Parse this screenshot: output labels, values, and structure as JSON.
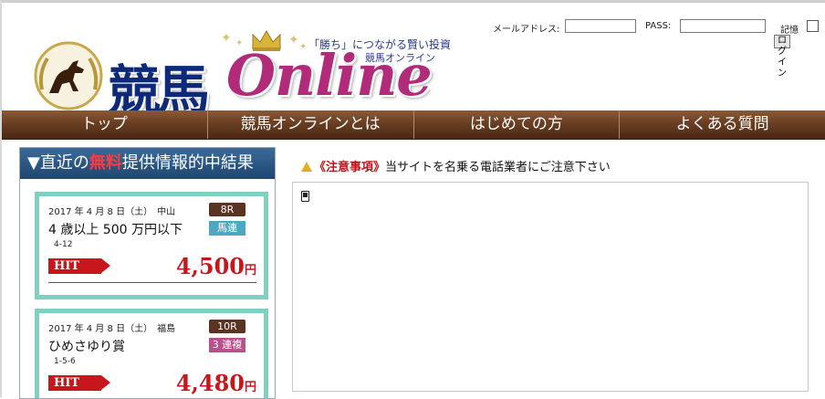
{
  "brand": {
    "logo_kanji": "競馬",
    "logo_online": "Online",
    "tagline_line1": "「勝ち」につながる賢い投資",
    "tagline_line2": "競馬オンライン"
  },
  "login": {
    "email_label": "メールアドレス:",
    "email_value": "",
    "pass_label": "PASS:",
    "pass_value": "",
    "remember_label": "記憶",
    "submit_label": "ログイン"
  },
  "nav": [
    {
      "label": "トップ"
    },
    {
      "label": "競馬オンラインとは"
    },
    {
      "label": "はじめての方"
    },
    {
      "label": "よくある質問"
    }
  ],
  "sidebar": {
    "title_pre": "▼直近の",
    "title_free": "無料",
    "title_post": "提供情報的中結果",
    "results": [
      {
        "date": "2017 年 4 月 8 日（土）　中山",
        "race_no": "8R",
        "race_name": "4 歳以上 500 万円以下",
        "bet_type": "馬連",
        "combo": "4-12",
        "hit_label": "HIT",
        "amount": "4,500",
        "unit": "円"
      },
      {
        "date": "2017 年 4 月 8 日（土）　福島",
        "race_no": "10R",
        "race_name": "ひめさゆり賞",
        "bet_type": "3 連複",
        "combo": "1-5-6",
        "hit_label": "HIT",
        "amount": "4,480",
        "unit": "円"
      }
    ]
  },
  "notice": {
    "warn_text": "《注意事項》",
    "message": "当サイトを名乗る電話業者にご注意下さい"
  },
  "colors": {
    "nav_brown": "#6a3e22",
    "sidebar_blue": "#1f4670",
    "card_mint": "#7fd0c0",
    "hit_red": "#c8161d",
    "logo_navy": "#0d2a7a",
    "logo_magenta": "#b22a7a"
  }
}
